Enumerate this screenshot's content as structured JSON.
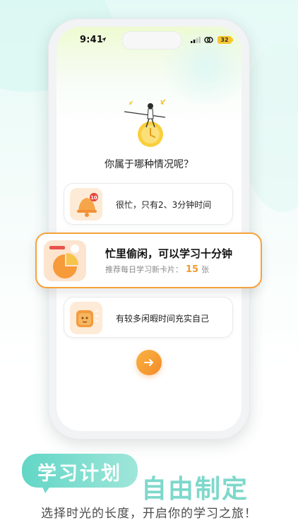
{
  "status_bar": {
    "time": "9:41",
    "battery": "32"
  },
  "question": "你属于哪种情况呢？",
  "options": [
    {
      "label": "很忙，只有2、3分钟时间",
      "icon": "bell-icon",
      "badge": "10"
    },
    {
      "title": "忙里偷闲，可以学习十分钟",
      "subtitle": "推荐每日学习新卡片：",
      "count": "15",
      "unit": "张",
      "icon": "pie-icon",
      "selected": true
    },
    {
      "label": "有较多闲暇时间充实自己",
      "icon": "bread-icon"
    }
  ],
  "next_button": {
    "icon": "arrow-right-icon"
  },
  "promo": {
    "badge": "学习计划",
    "headline": "自由制定",
    "tagline": "选择时光的长度，开启你的学习之旅！"
  },
  "colors": {
    "accent_orange": "#f6a23b",
    "accent_teal": "#62d6c6",
    "headline_teal": "#7ed8cb"
  }
}
